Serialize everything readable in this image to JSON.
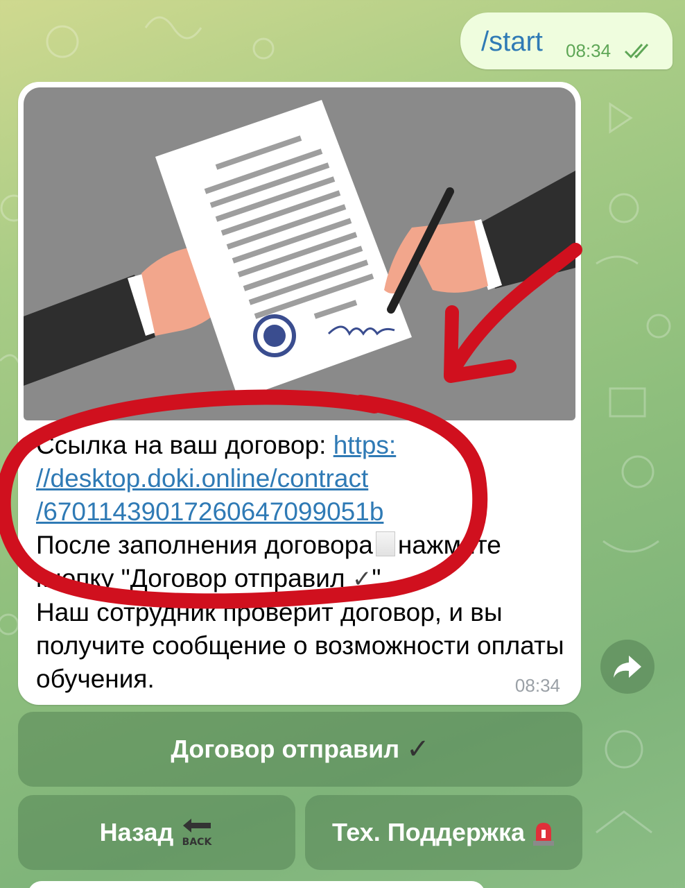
{
  "outgoing": {
    "text": "/start",
    "time": "08:34"
  },
  "incoming": {
    "text_prefix": "Ссылка на ваш договор: ",
    "link_line1": "https:",
    "link_line2": "//desktop.doki.online/contract",
    "link_line3": "/67011439017260647099051b",
    "line_after_fill": "После заполнения договора",
    "line_press": "нажмите кнопку \"Договор отправил",
    "line_press_end": "\".",
    "line_staff": "Наш сотрудник проверит договор, и вы получите сообщение о возможности оплаты обучения.",
    "time": "08:34"
  },
  "keyboard": {
    "sent_button": "Договор отправил",
    "back_button": "Назад",
    "back_icon_text": "BACK",
    "support_button": "Тех. Поддержка"
  },
  "colors": {
    "link": "#2f7ab5",
    "annotation": "#d0101e",
    "outgoing_bubble": "#effdde"
  }
}
